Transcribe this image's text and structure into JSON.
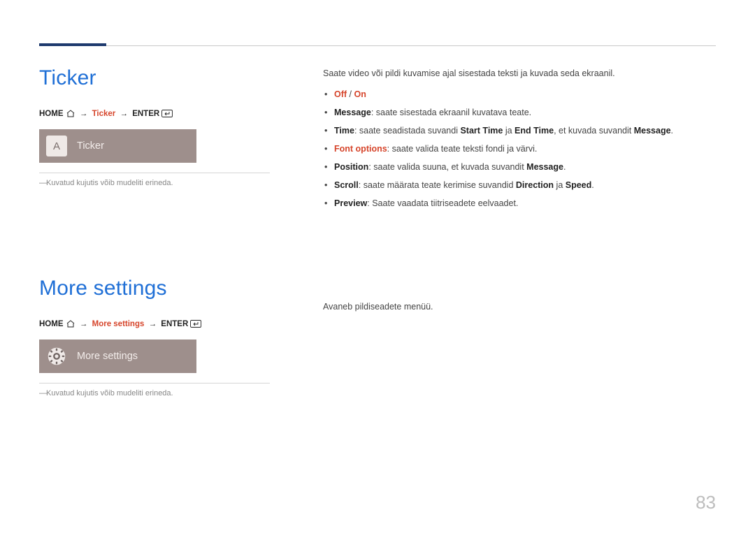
{
  "page_number": "83",
  "section1": {
    "title": "Ticker",
    "crumb": {
      "home": "HOME",
      "mid": "Ticker",
      "enter": "ENTER"
    },
    "card_icon_letter": "A",
    "card_label": "Ticker",
    "note": "Kuvatud kujutis võib mudeliti erineda."
  },
  "section2": {
    "title": "More settings",
    "crumb": {
      "home": "HOME",
      "mid": "More settings",
      "enter": "ENTER"
    },
    "card_label": "More settings",
    "note": "Kuvatud kujutis võib mudeliti erineda."
  },
  "right1": {
    "intro": "Saate video või pildi kuvamise ajal sisestada teksti ja kuvada seda ekraanil.",
    "items": {
      "offon_off": "Off",
      "offon_sep": " / ",
      "offon_on": "On",
      "message_k": "Message",
      "message_v": ": saate sisestada ekraanil kuvatava teate.",
      "time_k": "Time",
      "time_v1": ": saate seadistada suvandi ",
      "time_st": "Start Time",
      "time_v2": " ja ",
      "time_et": "End Time",
      "time_v3": ", et kuvada suvandit ",
      "time_msg": "Message",
      "time_v4": ".",
      "font_k": "Font options",
      "font_v": ": saate valida teate teksti fondi ja värvi.",
      "pos_k": "Position",
      "pos_v1": ": saate valida suuna, et kuvada suvandit ",
      "pos_msg": "Message",
      "pos_v2": ".",
      "scroll_k": "Scroll",
      "scroll_v1": ": saate määrata teate kerimise suvandid ",
      "scroll_dir": "Direction",
      "scroll_v2": " ja ",
      "scroll_spd": "Speed",
      "scroll_v3": ".",
      "prev_k": "Preview",
      "prev_v": ": Saate vaadata tiitriseadete eelvaadet."
    }
  },
  "right2": {
    "intro": "Avaneb pildiseadete menüü."
  }
}
